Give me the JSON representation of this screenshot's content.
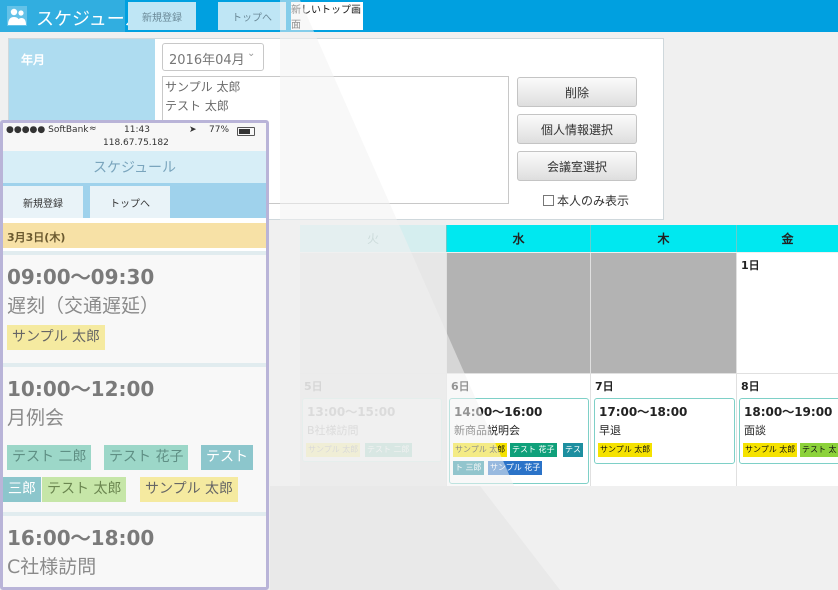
{
  "desktop": {
    "app_title": "スケジュール",
    "nav_tabs": [
      "新規登録",
      "トップへ",
      "新しいトップ画面"
    ],
    "form": {
      "month_label": "年月",
      "month_value": "2016年04月",
      "names": [
        "サンプル 太郎",
        "テスト 太郎"
      ],
      "buttons": {
        "delete": "削除",
        "personal": "個人情報選択",
        "room": "会議室選択"
      },
      "self_only_label": "本人のみ表示"
    },
    "calendar": {
      "weekdays": [
        "火",
        "水",
        "木",
        "金"
      ],
      "day_1": "1日",
      "days_row2": [
        "5日",
        "6日",
        "7日",
        "8日"
      ],
      "events": {
        "tue": {
          "time": "13:00〜15:00",
          "title": "B社様訪問",
          "tags": [
            "サンプル 太郎",
            "テスト 二郎"
          ]
        },
        "wed": {
          "time": "14:00〜16:00",
          "title": "新商品説明会",
          "tags": [
            "サンプル 太郎",
            "テスト 花子",
            "テス",
            "ト 三郎",
            "サンプル 花子"
          ]
        },
        "thu": {
          "time": "17:00〜18:00",
          "title": "早退",
          "tags": [
            "サンプル 太郎"
          ]
        },
        "fri": {
          "time": "18:00〜19:00",
          "title": "面談",
          "tags": [
            "サンプル 太郎",
            "テスト 太"
          ]
        }
      }
    }
  },
  "phone": {
    "status": {
      "carrier": "●●●●● SoftBank",
      "time": "11:43",
      "battery": "77%",
      "address": "118.67.75.182"
    },
    "app_title": "スケジュール",
    "tabs": [
      "新規登録",
      "トップへ"
    ],
    "date": "3月3日(木)",
    "events": [
      {
        "time": "09:00〜09:30",
        "title": "遅刻（交通遅延）",
        "tags": [
          "サンプル 太郎"
        ]
      },
      {
        "time": "10:00〜12:00",
        "title": "月例会",
        "tags": [
          "テスト 二郎",
          "テスト 花子",
          "テスト",
          "三郎",
          "テスト 太郎",
          "サンプル 太郎"
        ]
      },
      {
        "time": "16:00〜18:00",
        "title": "C社様訪問",
        "tags": []
      }
    ]
  },
  "colors": {
    "accent": "#00a0e0",
    "header_cyan": "#00e8f0",
    "tag_yellow": "#f5e200",
    "tag_green": "#0fa07a",
    "tag_blue": "#2b73c8"
  }
}
